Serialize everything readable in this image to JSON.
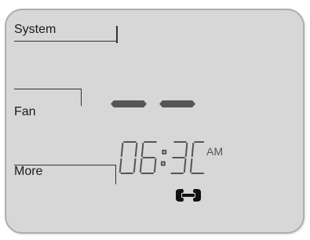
{
  "buttons": {
    "system": "System",
    "fan": "Fan",
    "more": "More"
  },
  "display": {
    "temperature_placeholder": "- -",
    "time": "06:30",
    "meridiem": "AM"
  },
  "icons": {
    "service": "wrench-icon"
  },
  "colors": {
    "screen_bg": "#d7d7d7",
    "ink": "#333333",
    "segment": "#555555"
  }
}
